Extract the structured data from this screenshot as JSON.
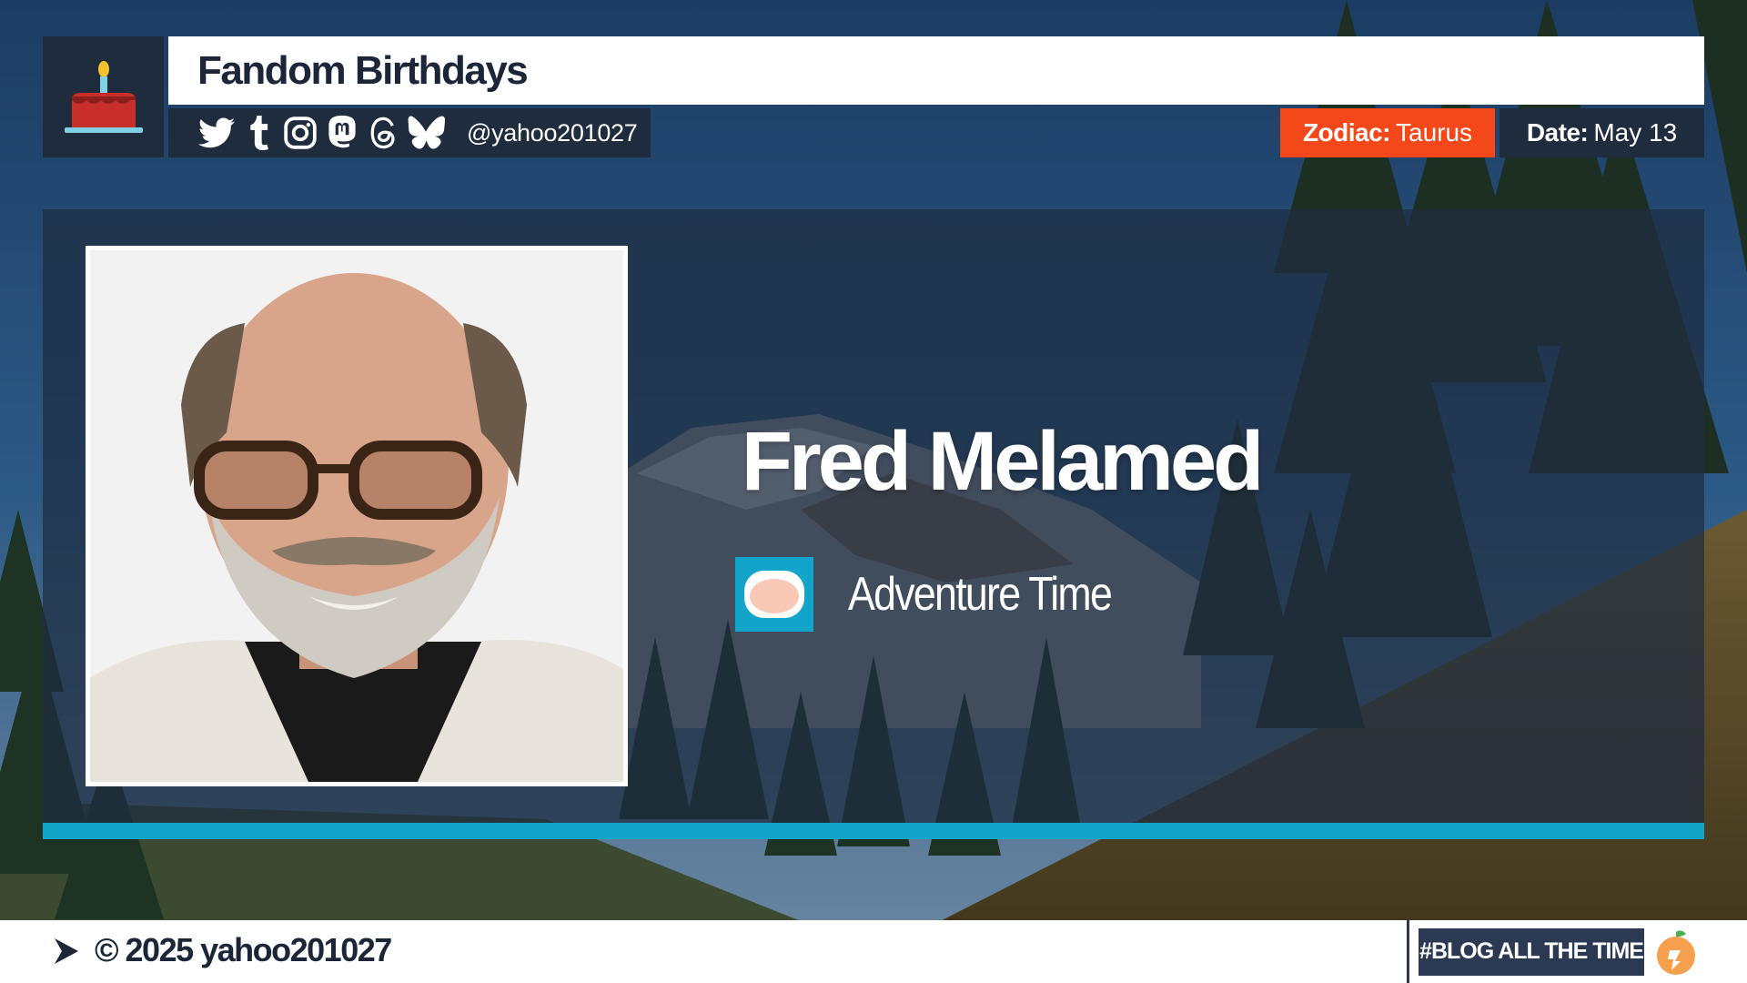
{
  "header": {
    "title": "Fandom Birthdays",
    "logo_icon": "birthday-cake-icon",
    "social_icons": [
      "twitter-icon",
      "tumblr-icon",
      "instagram-icon",
      "mastodon-icon",
      "threads-icon",
      "bluesky-icon"
    ],
    "handle": "@yahoo201027",
    "zodiac_label": "Zodiac:",
    "zodiac_value": "Taurus",
    "date_label": "Date:",
    "date_value": "May 13"
  },
  "main": {
    "person_name": "Fred Melamed",
    "fandom_name": "Adventure Time",
    "fandom_icon": "adventure-time-finn-icon",
    "photo": "portrait-photo"
  },
  "footer": {
    "copyright": "© 2025 yahoo201027",
    "badge": "#BLOG ALL THE TIME",
    "badge_icon": "peach-icon"
  },
  "colors": {
    "accent_orange": "#f4471a",
    "accent_cyan": "#12a4c9",
    "navy": "#1f2c3e",
    "title_text": "#1c2638"
  }
}
